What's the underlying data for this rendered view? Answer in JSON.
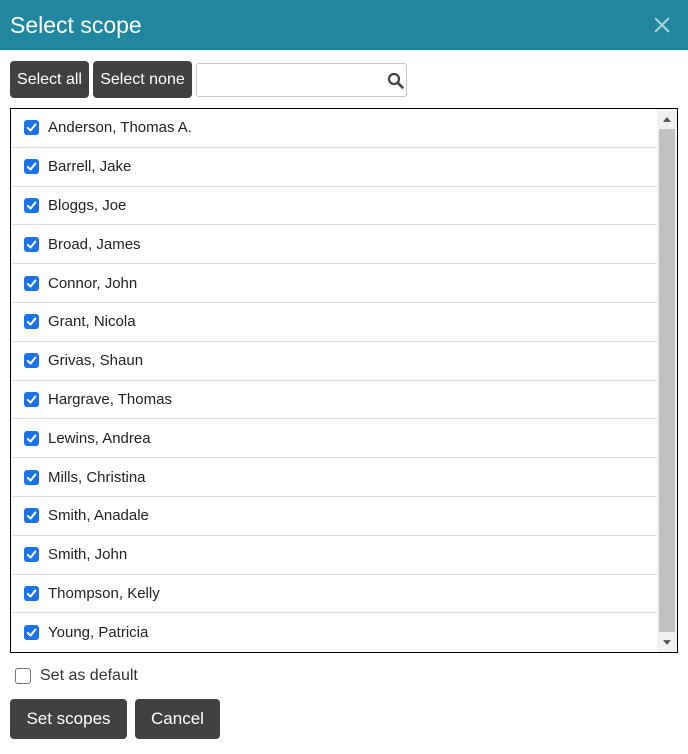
{
  "dialog": {
    "title": "Select scope",
    "close_icon": "close-icon"
  },
  "toolbar": {
    "select_all_label": "Select all",
    "select_none_label": "Select none",
    "search_value": "",
    "search_placeholder": "",
    "search_icon": "search-icon"
  },
  "scope_list": {
    "items": [
      {
        "label": "Anderson, Thomas A.",
        "checked": true
      },
      {
        "label": "Barrell, Jake",
        "checked": true
      },
      {
        "label": "Bloggs, Joe",
        "checked": true
      },
      {
        "label": "Broad, James",
        "checked": true
      },
      {
        "label": "Connor, John",
        "checked": true
      },
      {
        "label": "Grant, Nicola",
        "checked": true
      },
      {
        "label": "Grivas, Shaun",
        "checked": true
      },
      {
        "label": "Hargrave, Thomas",
        "checked": true
      },
      {
        "label": "Lewins, Andrea",
        "checked": true
      },
      {
        "label": "Mills, Christina",
        "checked": true
      },
      {
        "label": "Smith, Anadale",
        "checked": true
      },
      {
        "label": "Smith, John",
        "checked": true
      },
      {
        "label": "Thompson, Kelly",
        "checked": true
      },
      {
        "label": "Young, Patricia",
        "checked": true
      }
    ]
  },
  "default_option": {
    "label": "Set as default",
    "checked": false
  },
  "footer": {
    "set_scopes_label": "Set scopes",
    "cancel_label": "Cancel"
  },
  "colors": {
    "title_bar": "#21879e",
    "button_dark": "#3f4142",
    "checkbox_checked": "#1a73e8"
  }
}
